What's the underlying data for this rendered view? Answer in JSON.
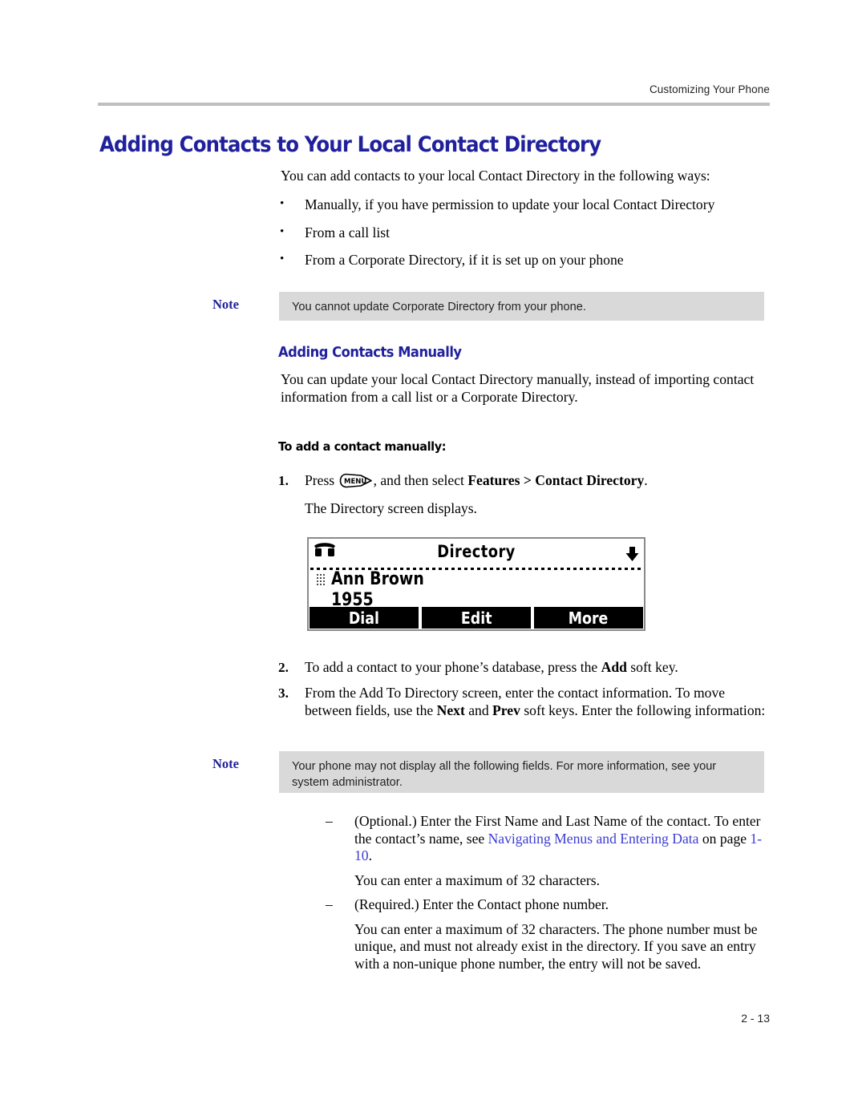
{
  "header": {
    "running_title": "Customizing Your Phone"
  },
  "footer": {
    "page_number": "2 - 13"
  },
  "colors": {
    "heading_blue": "#20209c",
    "link_blue": "#3b3bd4",
    "note_background": "#d9d9d9",
    "rule_gray": "#bfbfbf"
  },
  "section": {
    "title": "Adding Contacts to Your Local Contact Directory",
    "intro": "You can add contacts to your local Contact Directory in the following ways:",
    "bullets": [
      "Manually, if you have permission to update your local Contact Directory",
      "From a call list",
      "From a Corporate Directory, if it is set up on your phone"
    ]
  },
  "note1": {
    "label": "Note",
    "text": "You cannot update Corporate Directory from your phone."
  },
  "subsection": {
    "title": "Adding Contacts Manually",
    "paragraph": "You can update your local Contact Directory manually, instead of importing contact information from a call list or a Corporate Directory."
  },
  "procedure": {
    "title": "To add a contact manually:",
    "step1": {
      "number": "1.",
      "text_before": "Press",
      "key_icon_label": "MENU",
      "text_after_1": ", and then select",
      "bold_1": "Features > Contact Directory",
      "text_after_2": ".",
      "result": "The Directory screen displays."
    },
    "step2": {
      "number": "2.",
      "text_before": "To add a contact to your phone’s database, press the",
      "bold_1": "Add",
      "text_after": "soft key."
    },
    "step3": {
      "number": "3.",
      "text_before": "From the Add To Directory screen, enter the contact information. To move between fields, use the",
      "bold_1": "Next",
      "mid": "and",
      "bold_2": "Prev",
      "text_after": "soft keys. Enter the following information:"
    }
  },
  "phone_screen": {
    "title": "Directory",
    "contact_name": "Ann Brown",
    "contact_number": "1955",
    "scroll_indicator": "down-arrow",
    "status_icon": "handset-icon",
    "contact_icon": "keypad-icon",
    "softkeys": [
      "Dial",
      "Edit",
      "More"
    ]
  },
  "note2": {
    "label": "Note",
    "text": "Your phone may not display all the following fields. For more information, see your system administrator."
  },
  "fields": {
    "item1": {
      "dash": "–",
      "text_before": "(Optional.) Enter the First Name and Last Name of the contact. To enter the contact’s name, see",
      "link_text": "Navigating Menus and Entering Data",
      "text_mid": "on page",
      "link_page": "1-10",
      "text_after": "."
    },
    "item1_note": "You can enter a maximum of 32 characters.",
    "item2": {
      "dash": "–",
      "text": "(Required.) Enter the Contact phone number."
    },
    "item2_note": "You can enter a maximum of 32 characters. The phone number must be unique, and must not already exist in the directory. If you save an entry with a non-unique phone number, the entry will not be saved."
  }
}
